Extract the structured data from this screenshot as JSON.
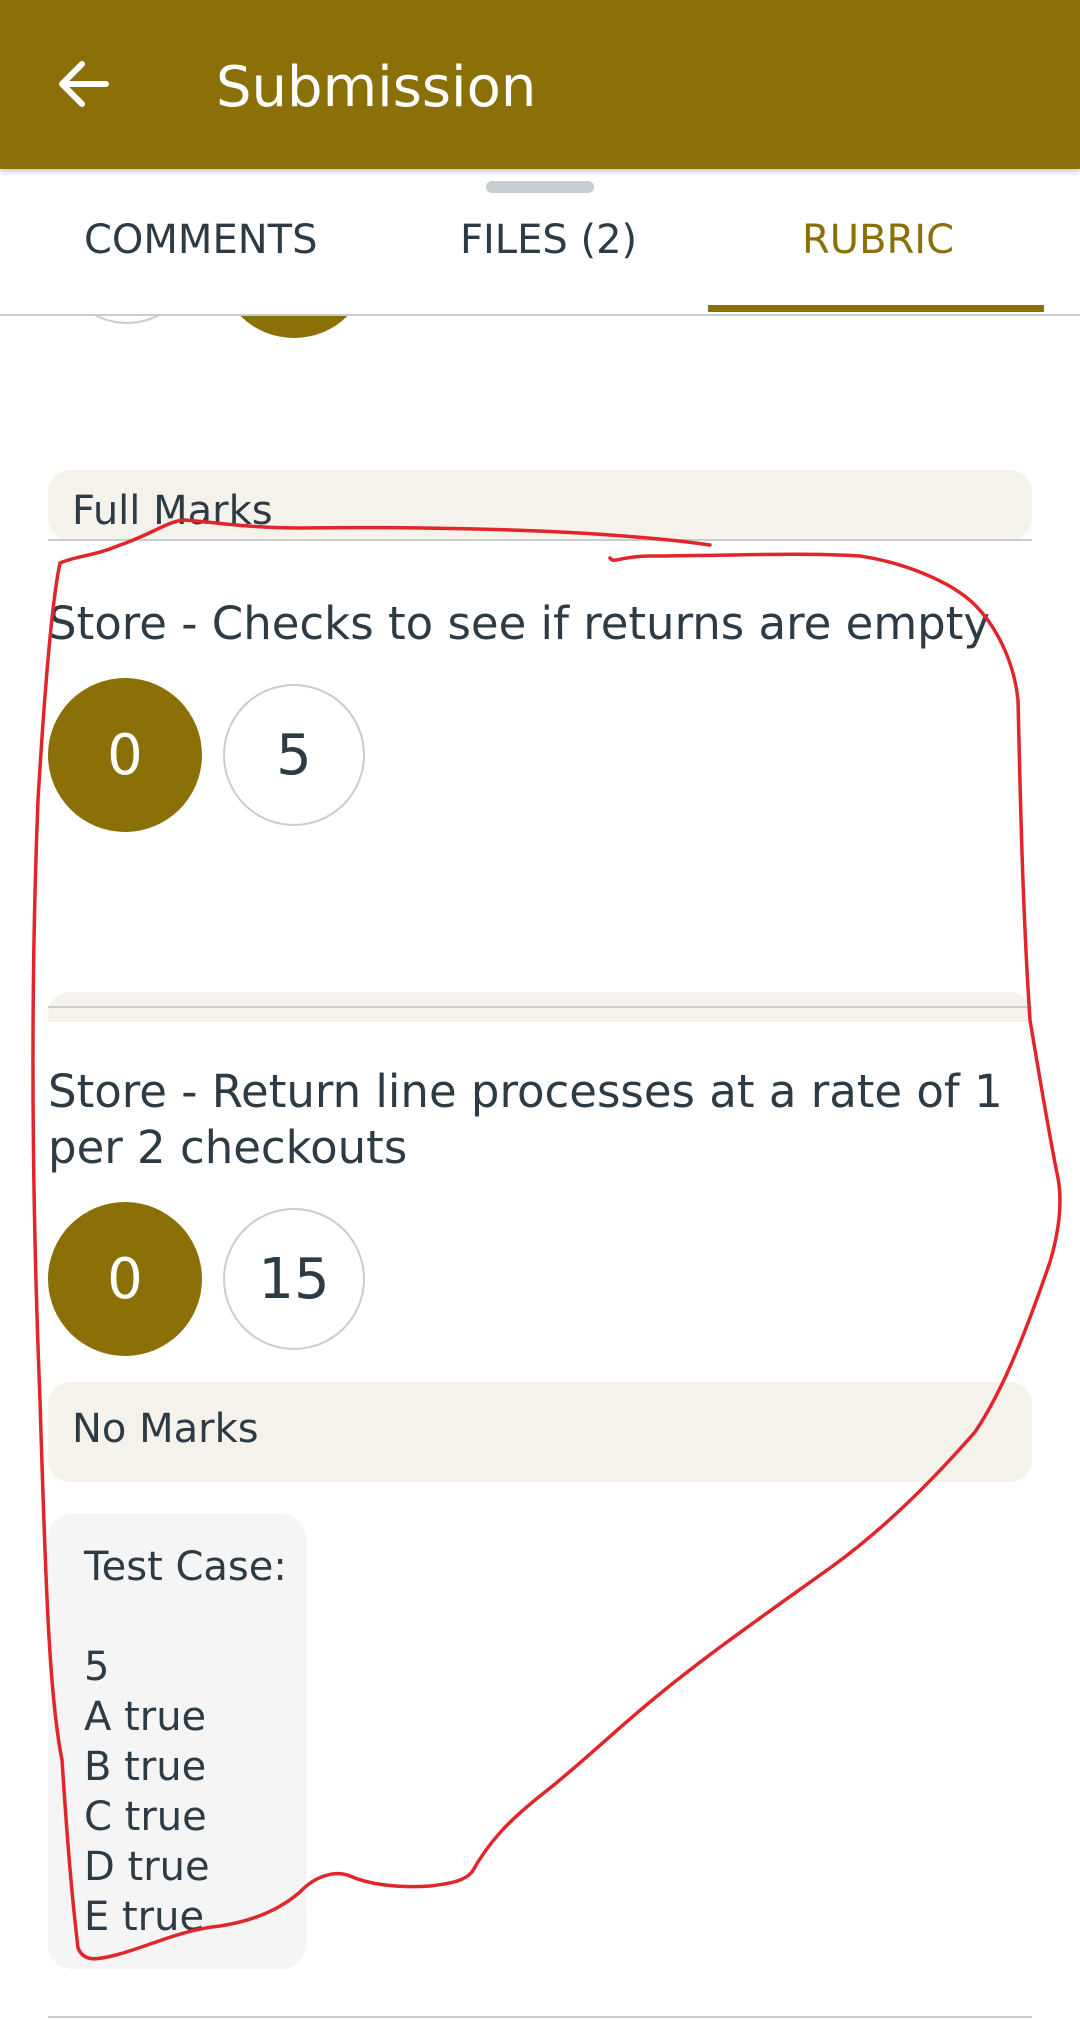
{
  "appbar": {
    "title": "Submission",
    "back_icon": "arrow-left-icon"
  },
  "tabs": [
    {
      "label": "COMMENTS",
      "selected": false
    },
    {
      "label": "FILES (2)",
      "selected": false
    },
    {
      "label": "RUBRIC",
      "selected": true
    }
  ],
  "rubric": {
    "previous_rating_label": "Full Marks",
    "criteria": [
      {
        "title": "Store - Checks to see if returns are empty",
        "options": [
          "0",
          "5"
        ],
        "selected_value": "0"
      },
      {
        "title": "Store - Return line processes at a rate of 1 per 2 checkouts",
        "options": [
          "0",
          "15"
        ],
        "selected_value": "0",
        "rating_label": "No Marks"
      }
    ],
    "comment": "Test Case:\n\n5\nA true\nB true\nC true\nD true\nE true"
  },
  "colors": {
    "accent": "#8b7008",
    "annotation": "#e0262b",
    "text": "#2d3b45"
  }
}
